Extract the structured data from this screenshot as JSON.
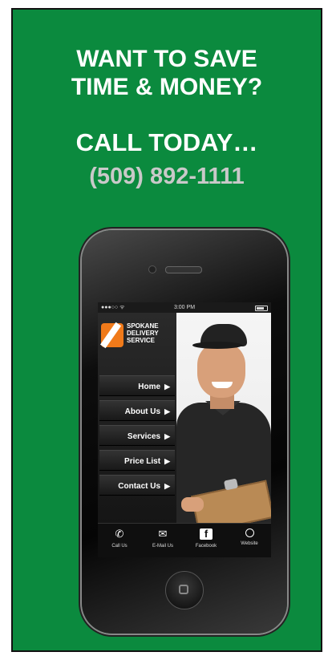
{
  "ad": {
    "headline_line1": "WANT TO SAVE",
    "headline_line2": "TIME & MONEY?",
    "cta": "CALL TODAY…",
    "phone_number": "(509) 892-1111",
    "colors": {
      "background": "#0b8a3e",
      "text": "#ffffff",
      "phone_number_text": "#c9c9c9"
    }
  },
  "app": {
    "status_bar": {
      "carrier": "●●●○○  ᯤ",
      "time": "3:00 PM",
      "location_icon": "➤"
    },
    "logo": {
      "line1": "SPOKANE",
      "line2": "DELIVERY",
      "line3": "SERVICE",
      "icon": "logo-mark-icon"
    },
    "menu": [
      {
        "label": "Home"
      },
      {
        "label": "About Us"
      },
      {
        "label": "Services"
      },
      {
        "label": "Price List"
      },
      {
        "label": "Contact Us"
      }
    ],
    "tabs": [
      {
        "label": "Call Us",
        "icon": "phone-icon"
      },
      {
        "label": "E-Mail Us",
        "icon": "email-icon"
      },
      {
        "label": "Facebook",
        "icon": "facebook-icon"
      },
      {
        "label": "Website",
        "icon": "globe-icon"
      }
    ],
    "accent": "#f07a1a"
  }
}
